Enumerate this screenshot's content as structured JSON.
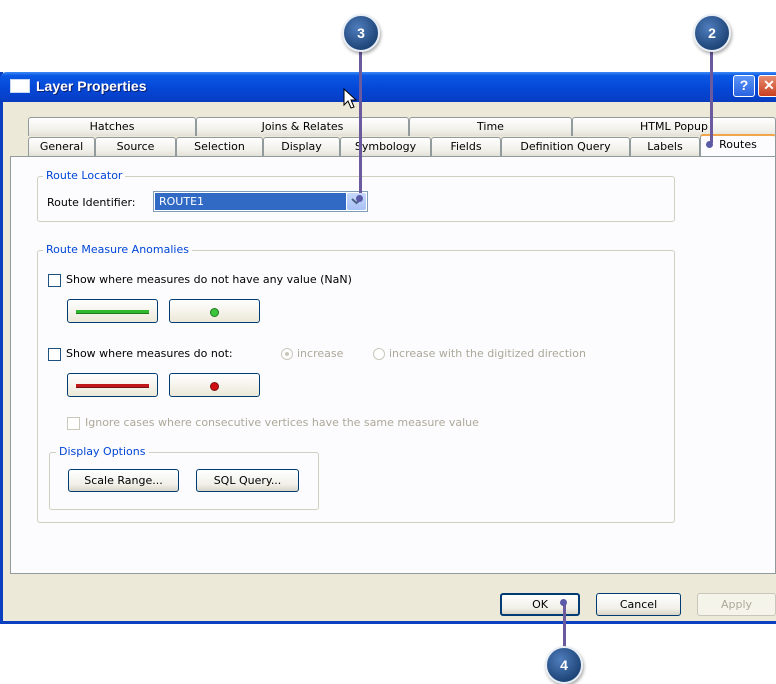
{
  "window": {
    "title": "Layer Properties",
    "help_glyph": "?",
    "close_glyph": "✕"
  },
  "tabs_row1": [
    "Hatches",
    "Joins & Relates",
    "Time",
    "HTML Popup"
  ],
  "tabs_row2": [
    "General",
    "Source",
    "Selection",
    "Display",
    "Symbology",
    "Fields",
    "Definition Query",
    "Labels",
    "Routes"
  ],
  "selected_tab": "Routes",
  "route_locator": {
    "group_label": "Route Locator",
    "identifier_label": "Route Identifier:",
    "identifier_value": "ROUTE1"
  },
  "anomalies": {
    "group_label": "Route Measure Anomalies",
    "nan_checkbox_label": "Show where measures do not have any value (NaN)",
    "not_checkbox_label": "Show where measures do not:",
    "radio_increase": "increase",
    "radio_increase_digitized": "increase with the digitized direction",
    "ignore_label": "Ignore cases where consecutive vertices have the same measure value",
    "nan_line_color": "#2db82d",
    "nan_point_color": "#3cc43c",
    "not_line_color": "#c01818",
    "not_point_color": "#d01010"
  },
  "display_options": {
    "group_label": "Display Options",
    "scale_range_label": "Scale Range...",
    "sql_query_label": "SQL Query..."
  },
  "buttons": {
    "ok": "OK",
    "cancel": "Cancel",
    "apply": "Apply"
  },
  "callouts": [
    "3",
    "2",
    "4"
  ]
}
